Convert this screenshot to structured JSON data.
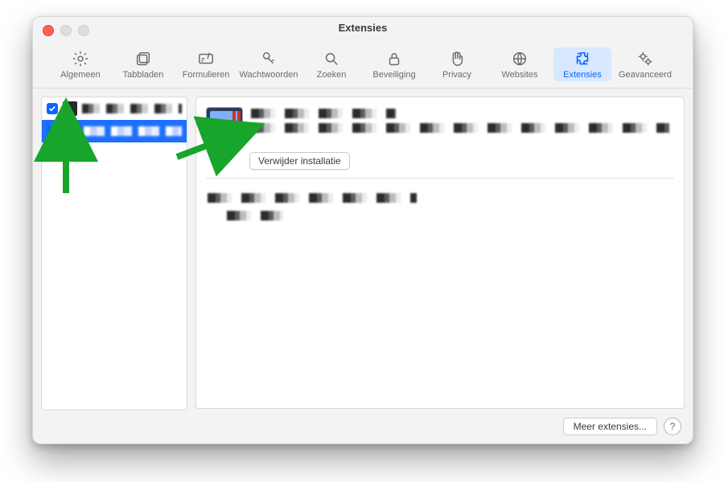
{
  "window": {
    "title": "Extensies"
  },
  "toolbar": {
    "items": [
      {
        "id": "algemeen",
        "label": "Algemeen"
      },
      {
        "id": "tabbladen",
        "label": "Tabbladen"
      },
      {
        "id": "formulieren",
        "label": "Formulieren"
      },
      {
        "id": "wachtwoorden",
        "label": "Wachtwoorden"
      },
      {
        "id": "zoeken",
        "label": "Zoeken"
      },
      {
        "id": "beveiliging",
        "label": "Beveiliging"
      },
      {
        "id": "privacy",
        "label": "Privacy"
      },
      {
        "id": "websites",
        "label": "Websites"
      },
      {
        "id": "extensies",
        "label": "Extensies"
      },
      {
        "id": "geavanceerd",
        "label": "Geavanceerd"
      }
    ],
    "selected_id": "extensies"
  },
  "sidebar": {
    "items": [
      {
        "enabled": true,
        "selected": false
      },
      {
        "enabled": true,
        "selected": true
      }
    ]
  },
  "detail": {
    "uninstall_label": "Verwijder installatie"
  },
  "footer": {
    "more_label": "Meer extensies...",
    "help_label": "?"
  },
  "icons": {
    "gear": "gear-icon",
    "tabs": "tabs-icon",
    "form": "form-icon",
    "key": "key-icon",
    "search": "search-icon",
    "lock": "lock-icon",
    "hand": "hand-icon",
    "globe": "globe-icon",
    "puzzle": "puzzle-icon",
    "gears": "gears-icon"
  },
  "colors": {
    "accent": "#0a66ff",
    "selection": "#1f6fff"
  }
}
